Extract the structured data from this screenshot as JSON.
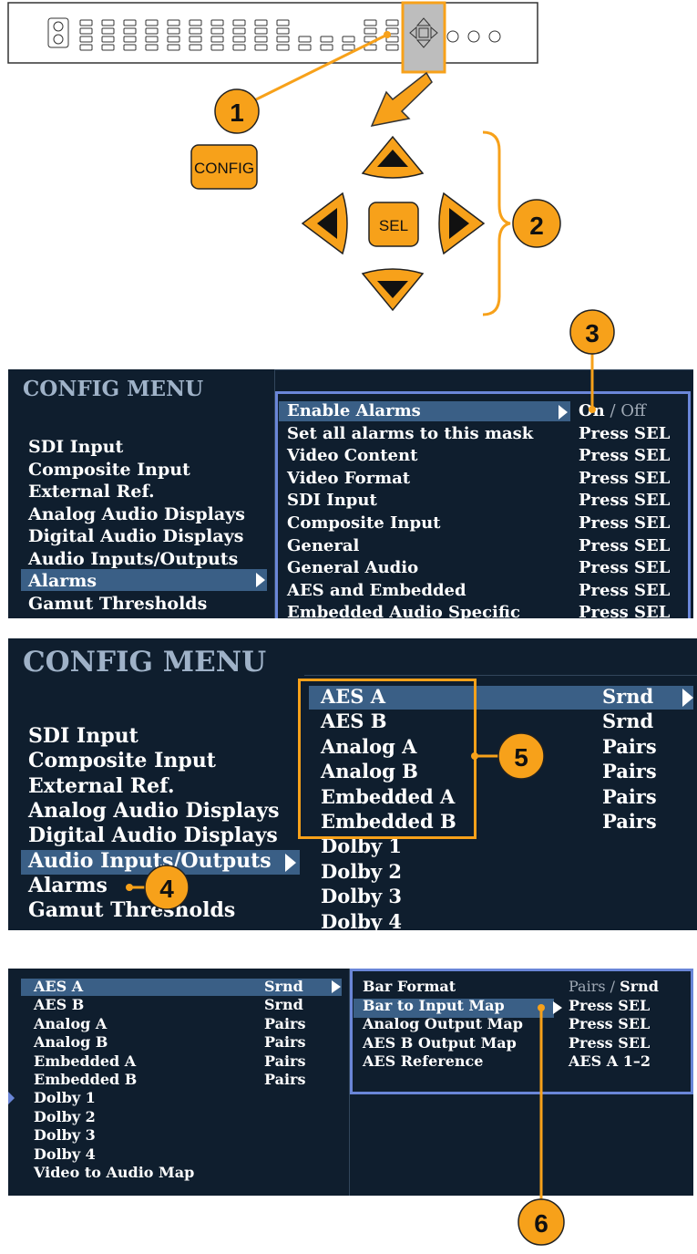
{
  "front_panel": {
    "config_label": "CONFIG",
    "sel_label": "SEL"
  },
  "callouts": [
    "1",
    "2",
    "3",
    "4",
    "5",
    "6"
  ],
  "screen1": {
    "title": "CONFIG MENU",
    "left_items": [
      "SDI Input",
      "Composite Input",
      "External Ref.",
      "Analog Audio Displays",
      "Digital Audio Displays",
      "Audio Inputs/Outputs",
      "Alarms",
      "Gamut Thresholds"
    ],
    "selected_left": "Alarms",
    "right_items": [
      {
        "label": "Enable Alarms",
        "value_on": "On",
        "value_sep": " / ",
        "value_off": "Off"
      },
      {
        "label": "Set all alarms to this mask",
        "value": "Press SEL"
      },
      {
        "label": "Video Content",
        "value": "Press SEL"
      },
      {
        "label": "Video Format",
        "value": "Press SEL"
      },
      {
        "label": "SDI Input",
        "value": "Press SEL"
      },
      {
        "label": "Composite Input",
        "value": "Press SEL"
      },
      {
        "label": "General",
        "value": "Press SEL"
      },
      {
        "label": "General Audio",
        "value": "Press SEL"
      },
      {
        "label": "AES and Embedded",
        "value": "Press SEL"
      },
      {
        "label": "Embedded Audio Specific",
        "value": "Press SEL"
      }
    ]
  },
  "screen2": {
    "title": "CONFIG MENU",
    "left_items": [
      "SDI Input",
      "Composite Input",
      "External Ref.",
      "Analog Audio Displays",
      "Digital Audio Displays",
      "Audio Inputs/Outputs",
      "Alarms",
      "Gamut Thresholds"
    ],
    "selected_left": "Audio Inputs/Outputs",
    "right_items": [
      {
        "label": "AES A",
        "value": "Srnd"
      },
      {
        "label": "AES B",
        "value": "Srnd"
      },
      {
        "label": "Analog A",
        "value": "Pairs"
      },
      {
        "label": "Analog B",
        "value": "Pairs"
      },
      {
        "label": "Embedded A",
        "value": "Pairs"
      },
      {
        "label": "Embedded B",
        "value": "Pairs"
      },
      {
        "label": "Dolby 1",
        "value": ""
      },
      {
        "label": "Dolby 2",
        "value": ""
      },
      {
        "label": "Dolby 3",
        "value": ""
      },
      {
        "label": "Dolby 4",
        "value": ""
      }
    ]
  },
  "screen3": {
    "left_items": [
      {
        "label": "AES A",
        "value": "Srnd"
      },
      {
        "label": "AES B",
        "value": "Srnd"
      },
      {
        "label": "Analog A",
        "value": "Pairs"
      },
      {
        "label": "Analog B",
        "value": "Pairs"
      },
      {
        "label": "Embedded A",
        "value": "Pairs"
      },
      {
        "label": "Embedded B",
        "value": "Pairs"
      },
      {
        "label": "Dolby 1",
        "value": ""
      },
      {
        "label": "Dolby 2",
        "value": ""
      },
      {
        "label": "Dolby 3",
        "value": ""
      },
      {
        "label": "Dolby 4",
        "value": ""
      },
      {
        "label": "Video to Audio Map",
        "value": ""
      }
    ],
    "right_items": [
      {
        "label": "Bar Format",
        "value_a": "Pairs",
        "value_sep": " / ",
        "value_b": "Srnd"
      },
      {
        "label": "Bar to Input Map",
        "value": "Press SEL"
      },
      {
        "label": "Analog Output Map",
        "value": "Press SEL"
      },
      {
        "label": "AES B Output Map",
        "value": "Press SEL"
      },
      {
        "label": "AES Reference",
        "value": "AES A 1–2"
      }
    ]
  },
  "colors": {
    "screen_bg": "#0f1e2e",
    "highlight": "#3a5f86",
    "callout_orange": "#f7a11a",
    "frame_blue": "#6a86d8",
    "frame_orange": "#f7a11a"
  }
}
